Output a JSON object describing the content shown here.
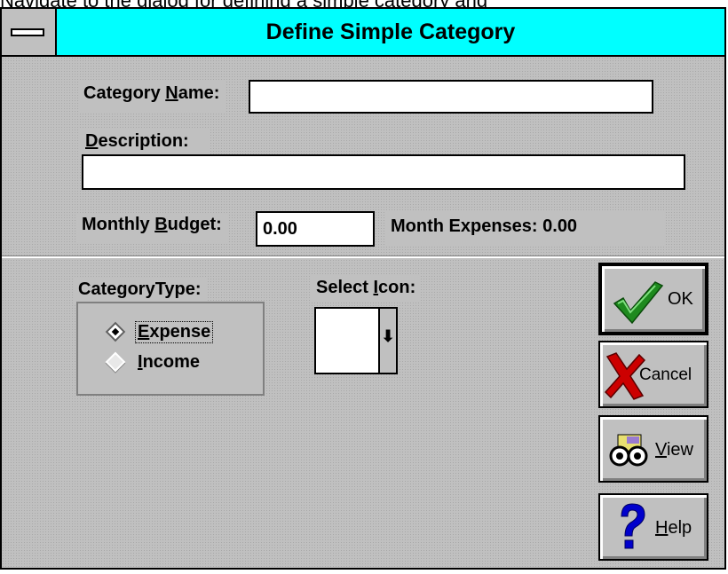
{
  "top_text": "Navigate to the dialog for defining a simple category and",
  "window": {
    "title": "Define Simple Category"
  },
  "form": {
    "category_name_label": {
      "before": "Category ",
      "key": "N",
      "after": "ame:"
    },
    "category_name_value": "",
    "description_label": {
      "key": "D",
      "after": "escription:"
    },
    "description_value": "",
    "monthly_budget_label": {
      "before": "Monthly ",
      "key": "B",
      "after": "udget:"
    },
    "monthly_budget_value": "0.00",
    "month_expenses_text": "Month Expenses: 0.00"
  },
  "category_type": {
    "label": "CategoryType:",
    "options": [
      {
        "key": "E",
        "after": "xpense",
        "selected": true
      },
      {
        "key": "I",
        "after": "ncome",
        "selected": false
      }
    ]
  },
  "select_icon": {
    "label": {
      "before": "Select ",
      "key": "I",
      "after": "con:"
    },
    "value": ""
  },
  "buttons": {
    "ok": "OK",
    "cancel": "Cancel",
    "view": {
      "key": "V",
      "after": "iew"
    },
    "help": {
      "key": "H",
      "after": "elp"
    }
  },
  "colors": {
    "titlebar": "#00ffff",
    "dialog_bg": "#c0c0c0",
    "check_green": "#1e8a1e",
    "cancel_red": "#cc0000",
    "help_blue": "#0000cc"
  },
  "icons": [
    "system-menu-icon",
    "radio-icon",
    "dropdown-arrow-icon",
    "checkmark-icon",
    "x-icon",
    "binoculars-icon",
    "question-mark-icon"
  ]
}
